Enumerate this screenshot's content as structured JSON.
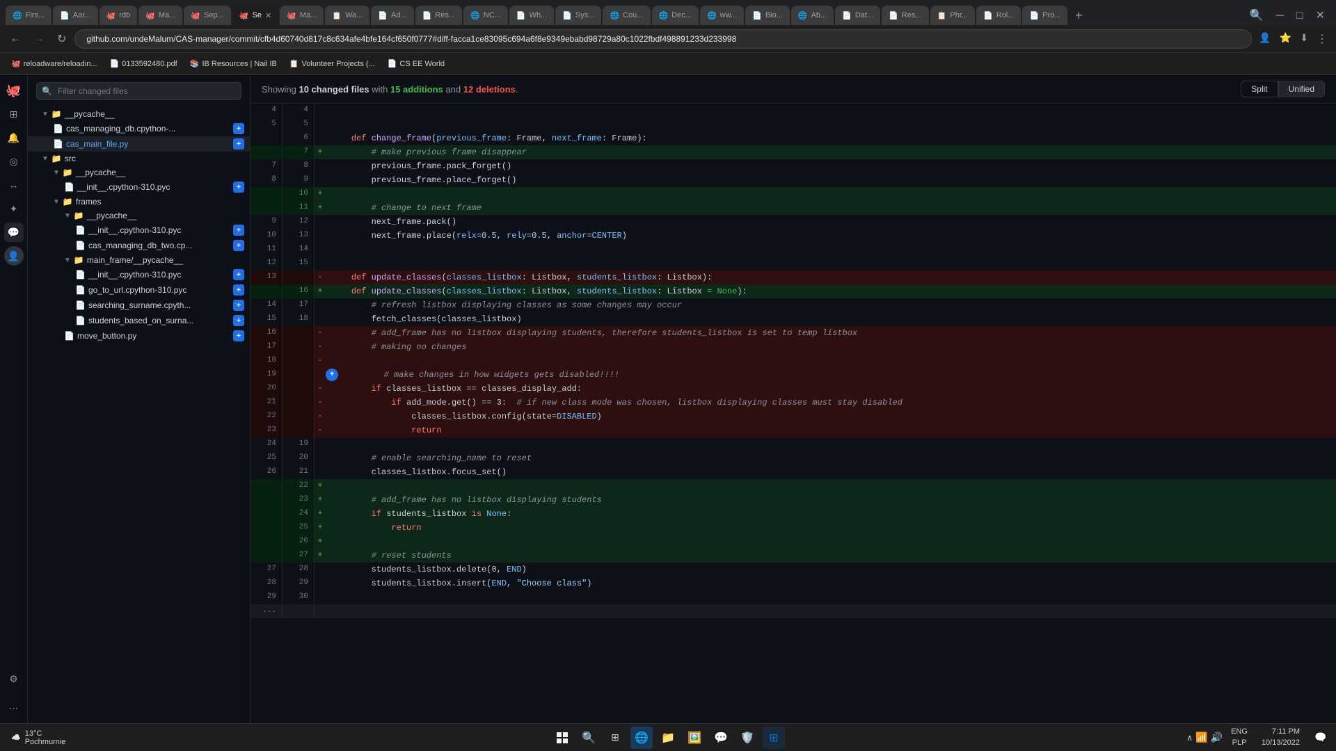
{
  "browser": {
    "tabs": [
      {
        "id": "t1",
        "label": "Firs...",
        "favicon": "🌐",
        "active": false
      },
      {
        "id": "t2",
        "label": "Aar...",
        "favicon": "📄",
        "active": false
      },
      {
        "id": "t3",
        "label": "rdb",
        "favicon": "🐙",
        "active": false
      },
      {
        "id": "t4",
        "label": "Ma...",
        "favicon": "🐙",
        "active": false
      },
      {
        "id": "t5",
        "label": "Sep...",
        "favicon": "🐙",
        "active": false
      },
      {
        "id": "t6",
        "label": "Se✕",
        "favicon": "🐙",
        "active": true
      },
      {
        "id": "t7",
        "label": "Ma...",
        "favicon": "🐙",
        "active": false
      },
      {
        "id": "t8",
        "label": "Wa...",
        "favicon": "📋",
        "active": false
      },
      {
        "id": "t9",
        "label": "Ad...",
        "favicon": "📄",
        "active": false
      },
      {
        "id": "t10",
        "label": "Res...",
        "favicon": "📄",
        "active": false
      },
      {
        "id": "t11",
        "label": "NC...",
        "favicon": "🌐",
        "active": false
      },
      {
        "id": "t12",
        "label": "Wh...",
        "favicon": "📄",
        "active": false
      },
      {
        "id": "t13",
        "label": "Sys...",
        "favicon": "📄",
        "active": false
      },
      {
        "id": "t14",
        "label": "Cou...",
        "favicon": "🌐",
        "active": false
      },
      {
        "id": "t15",
        "label": "Dec...",
        "favicon": "🌐",
        "active": false
      },
      {
        "id": "t16",
        "label": "ww...",
        "favicon": "🌐",
        "active": false
      },
      {
        "id": "t17",
        "label": "Bio...",
        "favicon": "📄",
        "active": false
      },
      {
        "id": "t18",
        "label": "Ab...",
        "favicon": "🌐",
        "active": false
      },
      {
        "id": "t19",
        "label": "Dat...",
        "favicon": "📄",
        "active": false
      },
      {
        "id": "t20",
        "label": "Res...",
        "favicon": "📄",
        "active": false
      },
      {
        "id": "t21",
        "label": "Phr...",
        "favicon": "📋",
        "active": false
      },
      {
        "id": "t22",
        "label": "Rol...",
        "favicon": "📄",
        "active": false
      },
      {
        "id": "t23",
        "label": "Pro...",
        "favicon": "📄",
        "active": false
      }
    ],
    "address": "github.com/undeMalum/CAS-manager/commit/cfb4d60740d817c8c634afe4bfe164cf650f0777#diff-facca1ce83095c694a6f8e9349ebabd98729a80c1022fbdf498891233d233998",
    "bookmarks": [
      {
        "label": "reloadware/reloadin...",
        "favicon": "🐙"
      },
      {
        "label": "0133592480.pdf",
        "favicon": "📄"
      },
      {
        "label": "IB Resources | Nail IB",
        "favicon": "📚"
      },
      {
        "label": "Volunteer Projects (..}",
        "favicon": "📋"
      },
      {
        "label": "CS EE World",
        "favicon": "📄"
      }
    ]
  },
  "diff_view": {
    "summary": {
      "prefix": "Showing ",
      "changed_files_count": "10",
      "changed_files_label": " changed files with ",
      "additions_count": "15",
      "additions_label": " additions",
      "and": " and ",
      "deletions_count": "12",
      "deletions_label": " deletions",
      "suffix": "."
    },
    "view_buttons": {
      "split_label": "Split",
      "unified_label": "Unified",
      "active": "unified"
    },
    "filter_placeholder": "Filter changed files"
  },
  "file_tree": {
    "items": [
      {
        "indent": 1,
        "type": "folder",
        "name": "__pycache__",
        "expanded": true
      },
      {
        "indent": 2,
        "type": "file",
        "name": "cas_managing_db.cpython-...",
        "badge": "+"
      },
      {
        "indent": 2,
        "type": "file",
        "name": "cas_main_file.py",
        "badge": "+",
        "active": true
      },
      {
        "indent": 1,
        "type": "folder",
        "name": "src",
        "expanded": true
      },
      {
        "indent": 2,
        "type": "folder",
        "name": "__pycache__",
        "expanded": true
      },
      {
        "indent": 3,
        "type": "file",
        "name": "__init__.cpython-310.pyc",
        "badge": "+"
      },
      {
        "indent": 2,
        "type": "folder",
        "name": "frames",
        "expanded": true
      },
      {
        "indent": 3,
        "type": "folder",
        "name": "__pycache__",
        "expanded": true
      },
      {
        "indent": 4,
        "type": "file",
        "name": "__init__.cpython-310.pyc",
        "badge": "+"
      },
      {
        "indent": 4,
        "type": "file",
        "name": "cas_managing_db_two.cp...",
        "badge": "+"
      },
      {
        "indent": 3,
        "type": "folder",
        "name": "main_frame/__pycache__",
        "expanded": true
      },
      {
        "indent": 4,
        "type": "file",
        "name": "__init__.cpython-310.pyc",
        "badge": "+"
      },
      {
        "indent": 4,
        "type": "file",
        "name": "go_to_url.cpython-310.pyc",
        "badge": "+"
      },
      {
        "indent": 4,
        "type": "file",
        "name": "searching_surname.cpyth...",
        "badge": "+"
      },
      {
        "indent": 4,
        "type": "file",
        "name": "students_based_on_surna...",
        "badge": "+"
      },
      {
        "indent": 3,
        "type": "file",
        "name": "move_button.py",
        "badge": "+"
      }
    ]
  },
  "diff_lines": [
    {
      "left_num": "4",
      "right_num": "4",
      "type": "context",
      "content": ""
    },
    {
      "left_num": "5",
      "right_num": "5",
      "type": "context",
      "content": ""
    },
    {
      "left_num": "",
      "right_num": "6",
      "type": "context",
      "content": "    def change_frame(previous_frame: Frame, next_frame: Frame):"
    },
    {
      "left_num": "",
      "right_num": "7",
      "type": "added",
      "content": "        # make previous frame disappear"
    },
    {
      "left_num": "7",
      "right_num": "8",
      "type": "context",
      "content": "        previous_frame.pack_forget()"
    },
    {
      "left_num": "8",
      "right_num": "9",
      "type": "context",
      "content": "        previous_frame.place_forget()"
    },
    {
      "left_num": "",
      "right_num": "10",
      "type": "added",
      "content": ""
    },
    {
      "left_num": "",
      "right_num": "11",
      "type": "added",
      "content": "        # change to next frame"
    },
    {
      "left_num": "9",
      "right_num": "12",
      "type": "context",
      "content": "        next_frame.pack()"
    },
    {
      "left_num": "10",
      "right_num": "13",
      "type": "context",
      "content": "        next_frame.place(relx=0.5, rely=0.5, anchor=CENTER)"
    },
    {
      "left_num": "11",
      "right_num": "14",
      "type": "context",
      "content": ""
    },
    {
      "left_num": "12",
      "right_num": "15",
      "type": "context",
      "content": ""
    },
    {
      "left_num": "13",
      "right_num": "",
      "type": "removed",
      "content": "    - def update_classes(classes_listbox: Listbox, students_listbox: Listbox):"
    },
    {
      "left_num": "",
      "right_num": "16",
      "type": "added",
      "content": "    + def update_classes(classes_listbox: Listbox, students_listbox: Listbox = None):"
    },
    {
      "left_num": "14",
      "right_num": "17",
      "type": "context",
      "content": "        # refresh listbox displaying classes as some changes may occur"
    },
    {
      "left_num": "15",
      "right_num": "18",
      "type": "context",
      "content": "        fetch_classes(classes_listbox)"
    },
    {
      "left_num": "16",
      "right_num": "",
      "type": "removed",
      "content": "        -  # add_frame has no listbox displaying students, therefore students_listbox is set to temp listbox"
    },
    {
      "left_num": "17",
      "right_num": "",
      "type": "removed",
      "content": "        -  # making no changes"
    },
    {
      "left_num": "18",
      "right_num": "",
      "type": "removed",
      "content": "        -"
    },
    {
      "left_num": "19",
      "right_num": "",
      "type": "removed_plus",
      "content": "        # make changes in how widgets gets disabled!!!!"
    },
    {
      "left_num": "20",
      "right_num": "",
      "type": "removed",
      "content": "        -  if classes_listbox == classes_display_add:"
    },
    {
      "left_num": "21",
      "right_num": "",
      "type": "removed",
      "content": "        -      if add_mode.get() == 3:  # if new class mode was chosen, listbox displaying classes must stay disabled"
    },
    {
      "left_num": "22",
      "right_num": "",
      "type": "removed",
      "content": "        -          classes_listbox.config(state=DISABLED)"
    },
    {
      "left_num": "23",
      "right_num": "",
      "type": "removed",
      "content": "        -          return"
    },
    {
      "left_num": "24",
      "right_num": "19",
      "type": "context",
      "content": ""
    },
    {
      "left_num": "25",
      "right_num": "20",
      "type": "context",
      "content": "        # enable searching_name to reset"
    },
    {
      "left_num": "26",
      "right_num": "21",
      "type": "context",
      "content": "        classes_listbox.focus_set()"
    },
    {
      "left_num": "",
      "right_num": "22",
      "type": "added",
      "content": ""
    },
    {
      "left_num": "",
      "right_num": "23",
      "type": "added",
      "content": "        # add_frame has no listbox displaying students"
    },
    {
      "left_num": "",
      "right_num": "24",
      "type": "added",
      "content": "        if students_listbox is None:"
    },
    {
      "left_num": "",
      "right_num": "25",
      "type": "added",
      "content": "            return"
    },
    {
      "left_num": "",
      "right_num": "26",
      "type": "added",
      "content": ""
    },
    {
      "left_num": "",
      "right_num": "27",
      "type": "added",
      "content": "        # reset students"
    },
    {
      "left_num": "27",
      "right_num": "28",
      "type": "context",
      "content": "        students_listbox.delete(0, END)"
    },
    {
      "left_num": "28",
      "right_num": "29",
      "type": "context",
      "content": "        students_listbox.insert(END, \"Choose class\")"
    },
    {
      "left_num": "29",
      "right_num": "30",
      "type": "context",
      "content": ""
    }
  ],
  "gh_sidebar_icons": [
    "octicon",
    "bell",
    "plus",
    "issues",
    "pulls",
    "explore",
    "notifications",
    "profile",
    "settings"
  ],
  "taskbar": {
    "weather": {
      "temp": "13°C",
      "location": "Pochmurnie"
    },
    "time": "7:11 PM",
    "date": "10/13/2022",
    "lang": "ENG",
    "layout": "PLP"
  }
}
